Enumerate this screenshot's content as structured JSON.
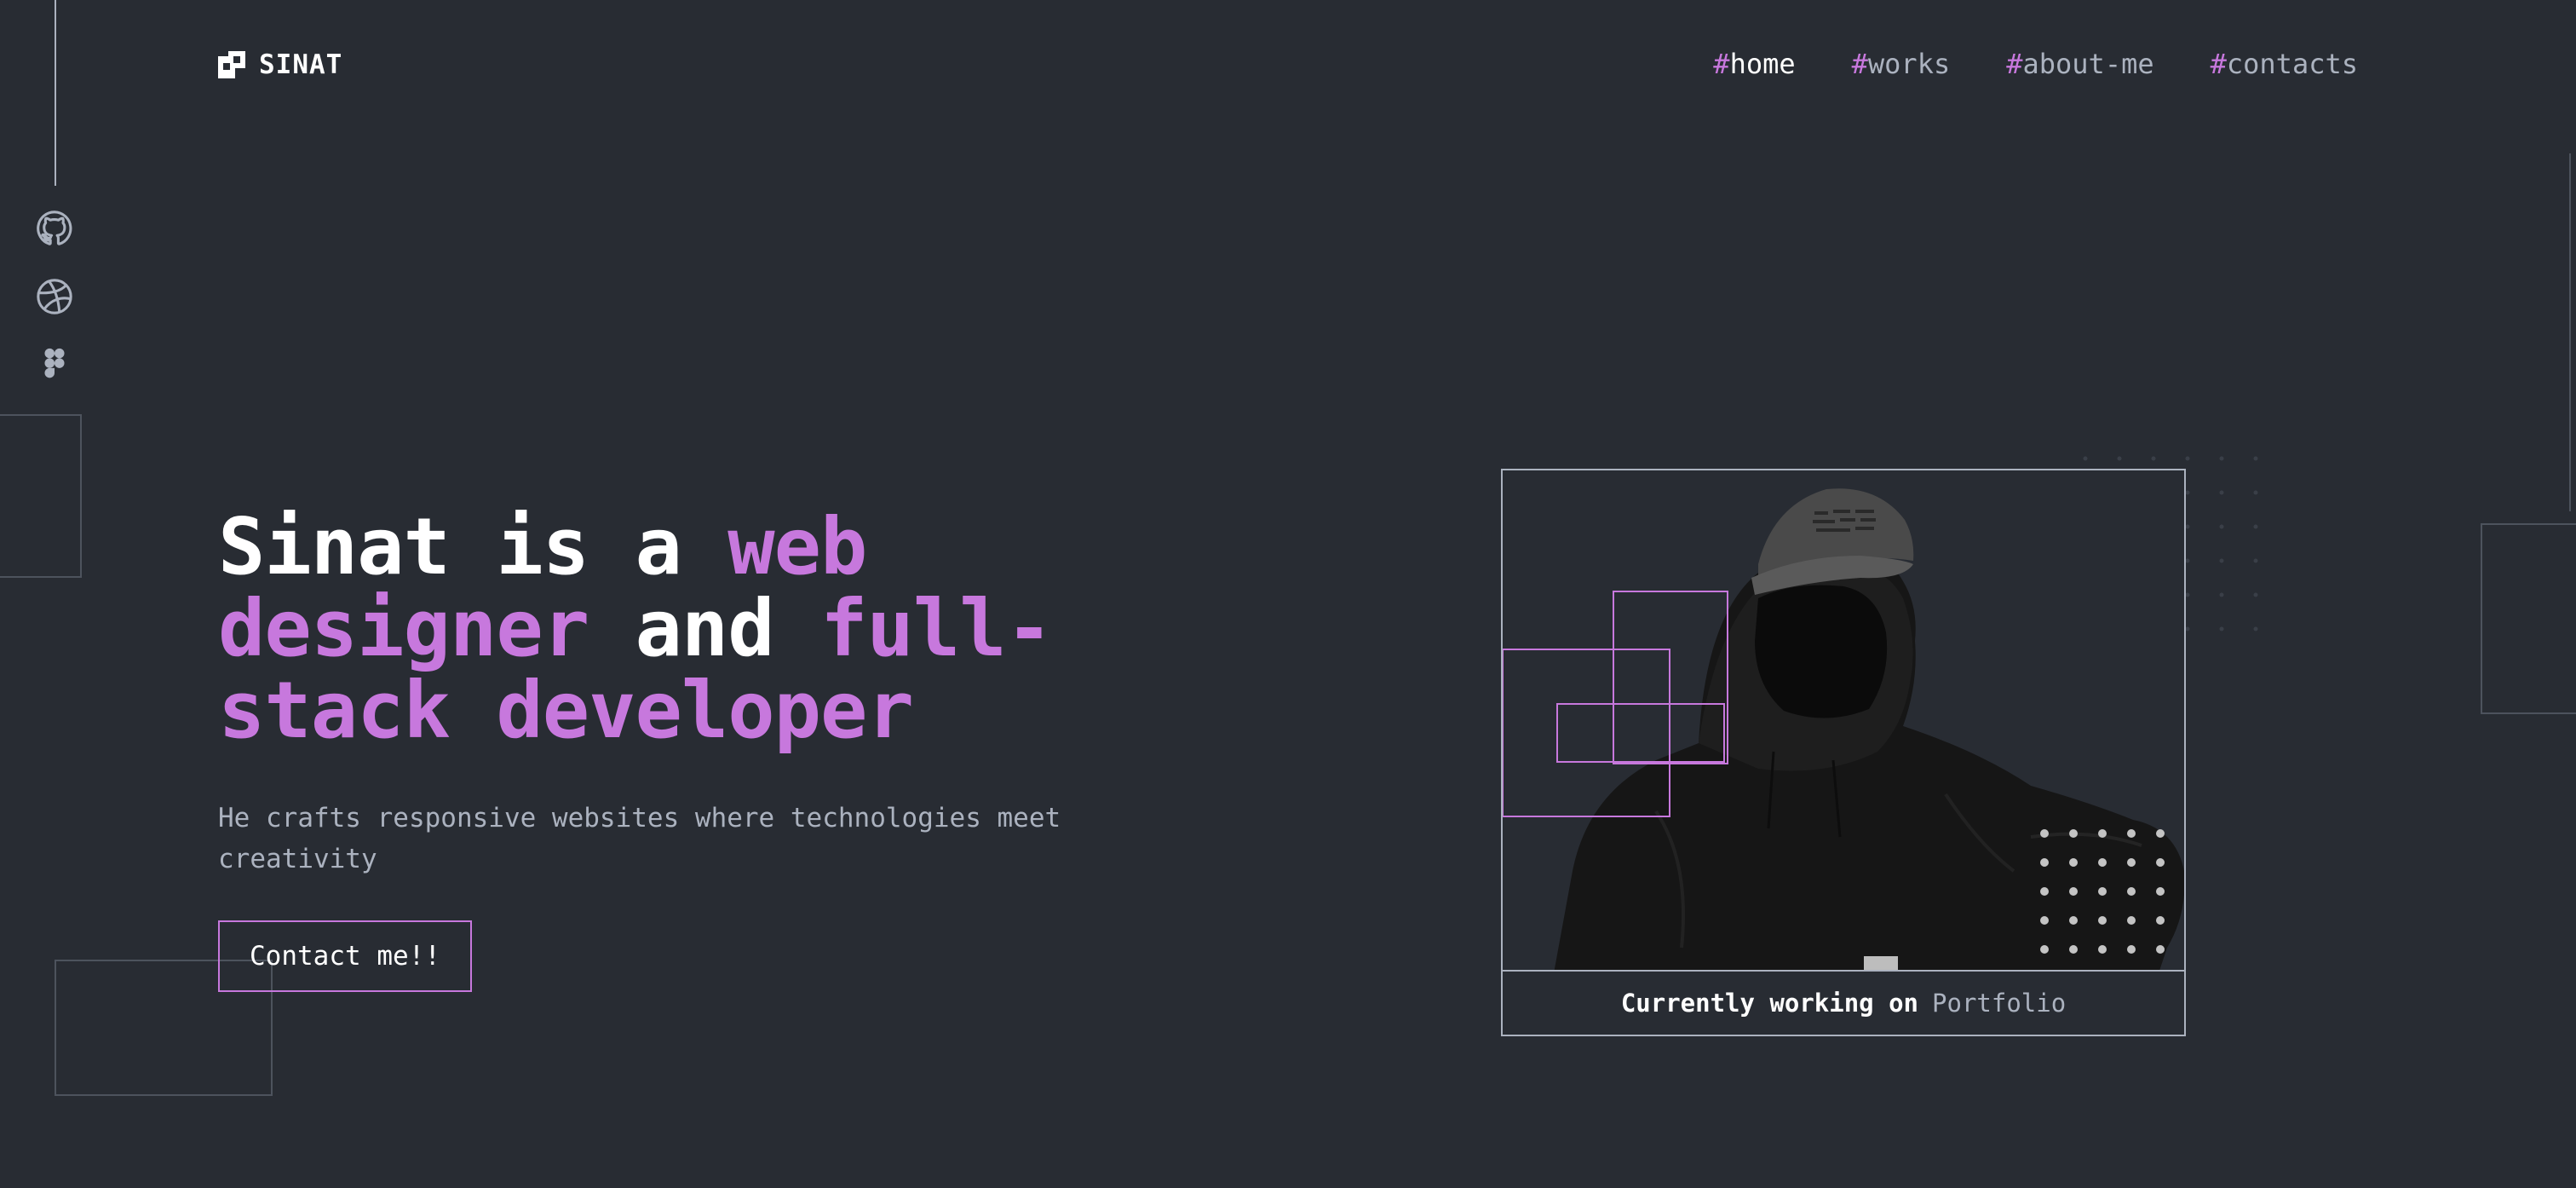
{
  "logo": {
    "text": "SINAT"
  },
  "nav": [
    {
      "hash": "#",
      "label": "home",
      "active": true
    },
    {
      "hash": "#",
      "label": "works",
      "active": false
    },
    {
      "hash": "#",
      "label": "about-me",
      "active": false
    },
    {
      "hash": "#",
      "label": "contacts",
      "active": false
    }
  ],
  "media": {
    "icons": [
      "github-icon",
      "dribbble-icon",
      "figma-icon"
    ]
  },
  "hero": {
    "headline": {
      "part1": "Sinat is a ",
      "accent1": "web designer",
      "part2": " and ",
      "accent2": "full-stack developer"
    },
    "subtitle": "He crafts responsive websites where technologies meet creativity",
    "cta_label": "Contact me!!"
  },
  "status": {
    "prefix": "Currently working on",
    "project": "Portfolio"
  },
  "colors": {
    "background": "#282c33",
    "accent": "#c778dd",
    "muted": "#abb2bf",
    "text": "#ffffff"
  }
}
